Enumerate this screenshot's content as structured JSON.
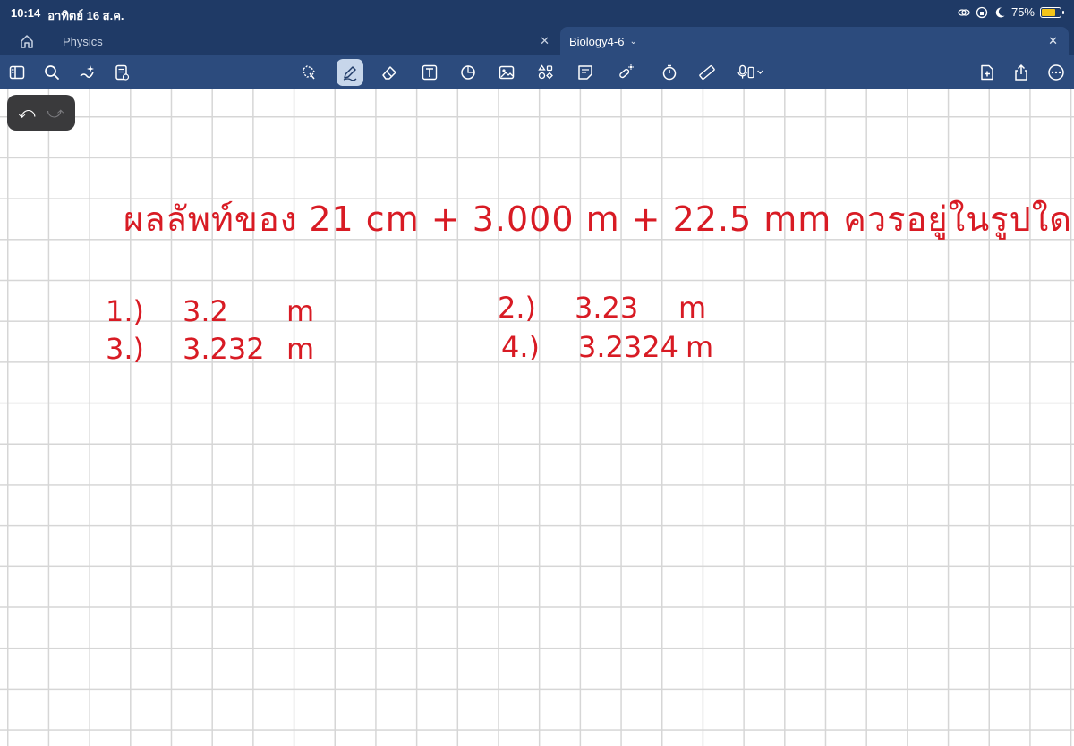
{
  "status": {
    "time": "10:14",
    "date": "อาทิตย์ 16 ส.ค.",
    "battery_percent": "75%",
    "battery_level": 0.75,
    "battery_color": "#f5c518"
  },
  "tabs": [
    {
      "label": "Physics",
      "active": false
    },
    {
      "label": "Biology4-6",
      "active": true
    }
  ],
  "toolbar": {
    "left": [
      "sidebar-icon",
      "search-icon",
      "magic-icon",
      "page-settings-icon"
    ],
    "center": [
      "lasso-icon",
      "pen-icon",
      "eraser-icon",
      "text-icon",
      "shapes-icon",
      "image-icon",
      "elements-icon",
      "sticky-note-icon",
      "laser-icon",
      "timer-icon",
      "ruler-icon",
      "mic-icon"
    ],
    "right": [
      "add-page-icon",
      "share-icon",
      "more-icon"
    ],
    "active_tool": "pen-icon"
  },
  "ink_color": "#d81b24",
  "note": {
    "question": "ผลลัพท์ของ 21 cm + 3.000 m + 22.5 mm ควรอยู่ในรูปใด",
    "options": [
      {
        "number": "1.)",
        "value": "3.2",
        "unit": "m"
      },
      {
        "number": "2.)",
        "value": "3.23",
        "unit": "m"
      },
      {
        "number": "3.)",
        "value": "3.232",
        "unit": "m"
      },
      {
        "number": "4.)",
        "value": "3.2324",
        "unit": "m"
      }
    ]
  }
}
